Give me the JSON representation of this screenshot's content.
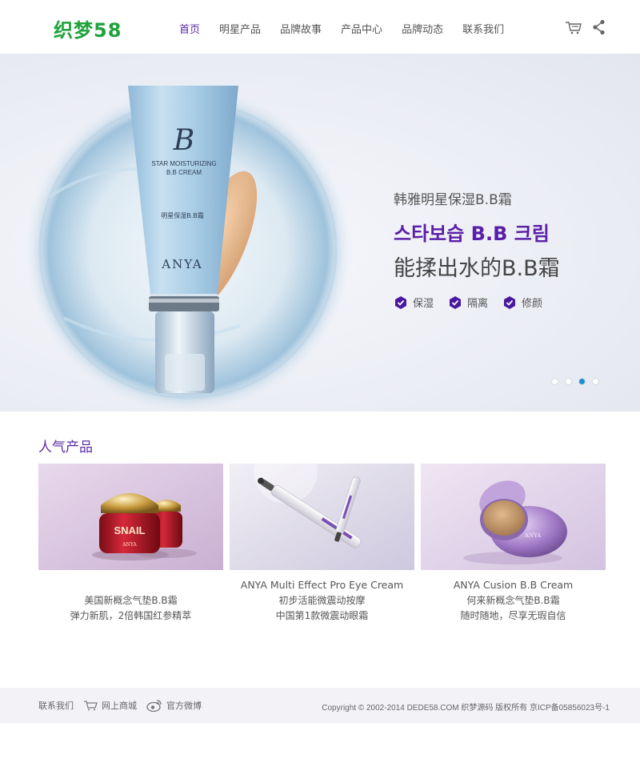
{
  "header": {
    "logo": "织梦58",
    "nav": [
      "首页",
      "明星产品",
      "品牌故事",
      "产品中心",
      "品牌动态",
      "联系我们"
    ],
    "active_nav": 0,
    "icons": [
      "cart-icon",
      "share-icon"
    ]
  },
  "banner": {
    "product_texts": {
      "brand_mark": "B",
      "line1": "STAR MOISTURIZING",
      "line2": "B.B CREAM",
      "cn_name": "明星保湿B.B霜",
      "brand": "ANYA"
    },
    "subtitle": "韩雅明星保湿B.B霜",
    "korean": "스타보습 B.B 크림",
    "headline": "能揉出水的B.B霜",
    "features": [
      "保湿",
      "隔离",
      "修颜"
    ],
    "slides": 4,
    "active_slide": 2
  },
  "products_section": {
    "title": "人气产品",
    "items": [
      {
        "name": "",
        "lines": [
          "美国新概念气垫B.B霜",
          "弹力新肌，2倍韩国红参精萃"
        ],
        "image_label": "SNAIL",
        "image_brand": "ANYA"
      },
      {
        "name": "ANYA Multi Effect Pro Eye Cream",
        "lines": [
          "初步活能微震动按摩",
          "中国第1款微震动眼霜"
        ]
      },
      {
        "name": "ANYA Cusion B.B Cream",
        "lines": [
          "何来新概念气垫B.B霜",
          "随时随地，尽享无瑕自信"
        ],
        "image_brand": "ANYA"
      }
    ]
  },
  "footer": {
    "links": [
      "联系我们",
      "网上商城",
      "官方微博"
    ],
    "copyright": "Copyright © 2002-2014 DEDE58.COM 织梦源码 版权所有   京ICP备05856023号-1"
  },
  "colors": {
    "accent": "#5a2aa6",
    "logo": "#1fa23a",
    "dot_active": "#1a8ed2",
    "footer_bg": "#f3f2f7"
  }
}
